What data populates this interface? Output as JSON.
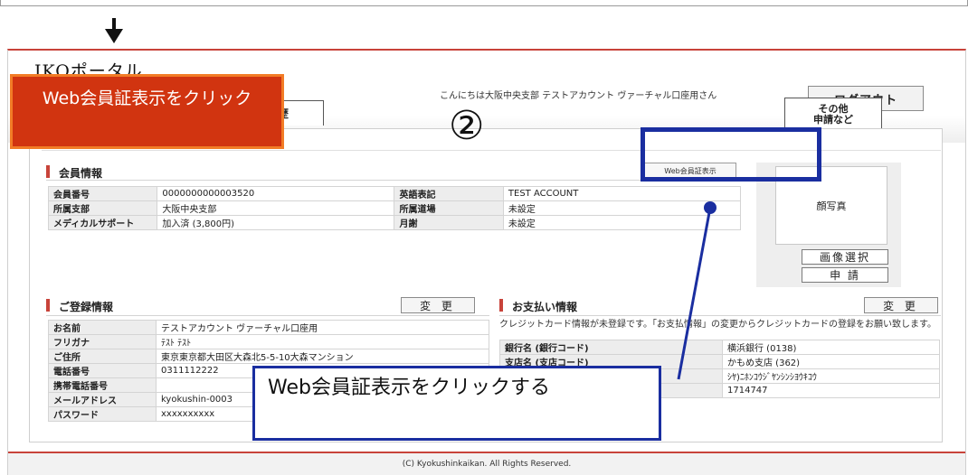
{
  "portal": {
    "title": "IKOポータル",
    "greeting": "こんにちは大阪中央支部 テストアカウント ヴァーチャル口座用さん",
    "logout_label": "ログアウト",
    "tab_history_label": "歴",
    "tab_other_line1": "その他",
    "tab_other_line2": "申請など"
  },
  "member": {
    "title": "会員情報",
    "web_card_button": "Web会員証表示",
    "rows": [
      {
        "k1": "会員番号",
        "v1": "0000000000003520",
        "k2": "英語表記",
        "v2": "TEST ACCOUNT"
      },
      {
        "k1": "所属支部",
        "v1": "大阪中央支部",
        "k2": "所属道場",
        "v2": "未設定"
      },
      {
        "k1": "メディカルサポート",
        "v1": "加入済 (3,800円)",
        "k2": "月謝",
        "v2": "未設定"
      }
    ],
    "photo_label": "顔写真",
    "select_image_label": "画像選択",
    "apply_label": "申 請"
  },
  "registration": {
    "title": "ご登録情報",
    "edit_label": "変 更",
    "rows": [
      {
        "k": "お名前",
        "v": "テストアカウント ヴァーチャル口座用"
      },
      {
        "k": "フリガナ",
        "v": "ﾃｽﾄ ﾃｽﾄ"
      },
      {
        "k": "ご住所",
        "v": "東京東京都大田区大森北5-5-10大森マンション"
      },
      {
        "k": "電話番号",
        "v": "0311112222"
      },
      {
        "k": "携帯電話番号",
        "v": ""
      },
      {
        "k": "メールアドレス",
        "v": "kyokushin-0003"
      },
      {
        "k": "パスワード",
        "v": "xxxxxxxxxx"
      }
    ]
  },
  "payment": {
    "title": "お支払い情報",
    "edit_label": "変 更",
    "note": "クレジットカード情報が未登録です。「お支払情報」の変更からクレジットカードの登録をお願い致します。",
    "rows": [
      {
        "k": "銀行名 (銀行コード)",
        "v": "横浜銀行 (0138)"
      },
      {
        "k": "支店名 (支店コード)",
        "v": "かもめ支店 (362)"
      },
      {
        "k": "",
        "v": "ｼﾔ)ﾆﾎﾝｺｳｼﾞﾔﾝｼﾝｼﾖｳｷｺｳ"
      },
      {
        "k": "",
        "v": "1714747"
      }
    ]
  },
  "footer": "(C) Kyokushinkaikan. All Rights Reserved.",
  "annotations": {
    "orange_callout": "Web会員証表示をクリック",
    "step": "②",
    "blue_callout": "Web会員証表示をクリックする",
    "colors": {
      "orange_fill": "#d13410",
      "orange_border": "#f27c26",
      "blue": "#1a2ea0",
      "accent_red": "#c8433a"
    }
  }
}
